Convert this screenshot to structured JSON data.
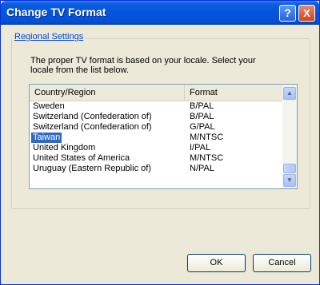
{
  "window": {
    "title": "Change TV Format",
    "help_glyph": "?",
    "close_glyph": "X"
  },
  "group": {
    "legend": "Regional Settings",
    "description": "The proper TV format is based on your locale. Select your locale from the list below."
  },
  "list": {
    "headers": [
      "Country/Region",
      "Format"
    ],
    "rows": [
      {
        "country": "Sweden",
        "format": "B/PAL"
      },
      {
        "country": "Switzerland (Confederation of)",
        "format": "B/PAL"
      },
      {
        "country": "Switzerland (Confederation of)",
        "format": "G/PAL"
      },
      {
        "country": "Taiwan",
        "format": "M/NTSC"
      },
      {
        "country": "United Kingdom",
        "format": "I/PAL"
      },
      {
        "country": "United States of America",
        "format": "M/NTSC"
      },
      {
        "country": "Uruguay (Eastern Republic of)",
        "format": "N/PAL"
      }
    ],
    "selected_country": "Taiwan"
  },
  "buttons": {
    "ok": "OK",
    "cancel": "Cancel"
  },
  "icons": {
    "scroll_up": "▲",
    "scroll_down": "▼"
  }
}
